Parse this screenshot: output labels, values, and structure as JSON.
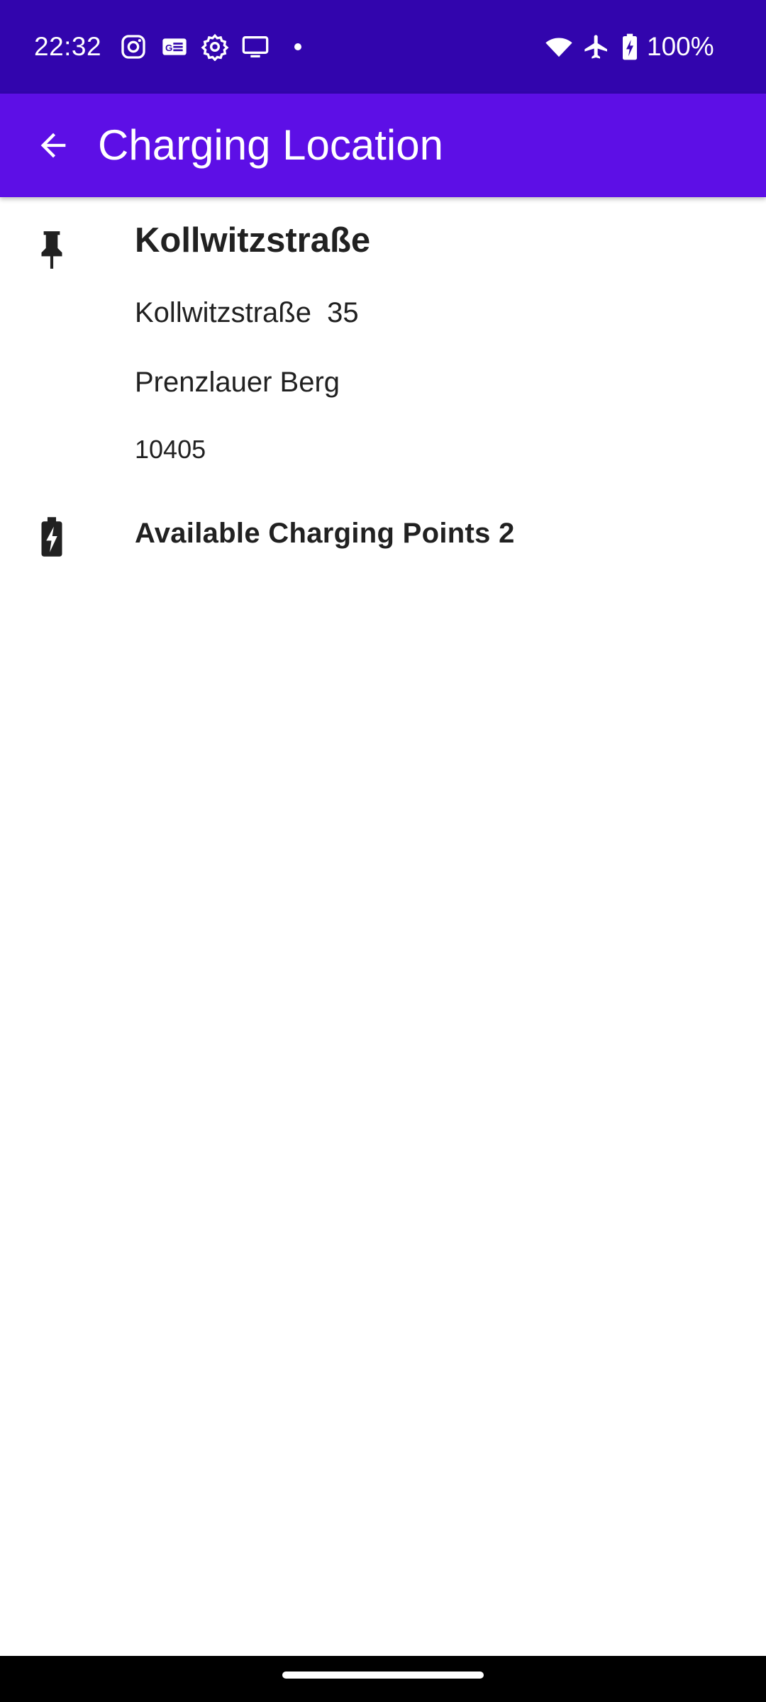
{
  "status_bar": {
    "time": "22:32",
    "battery_percent": "100%",
    "notification_icons": [
      "instagram-icon",
      "news-icon",
      "settings-icon",
      "cast-icon",
      "dot-icon"
    ],
    "system_icons": [
      "wifi-icon",
      "airplane-mode-icon",
      "battery-charging-icon"
    ],
    "background_color": "#3205ad"
  },
  "app_bar": {
    "title": "Charging Location",
    "back_icon": "arrow-back-icon",
    "background_color": "#5d0fe6"
  },
  "location": {
    "icon": "pin-icon",
    "name": "Kollwitzstraße",
    "street": "Kollwitzstraße  35",
    "district": "Prenzlauer Berg",
    "postal_code": "10405"
  },
  "charging": {
    "icon": "battery-charging-icon",
    "available_points_label": "Available Charging Points 2"
  }
}
